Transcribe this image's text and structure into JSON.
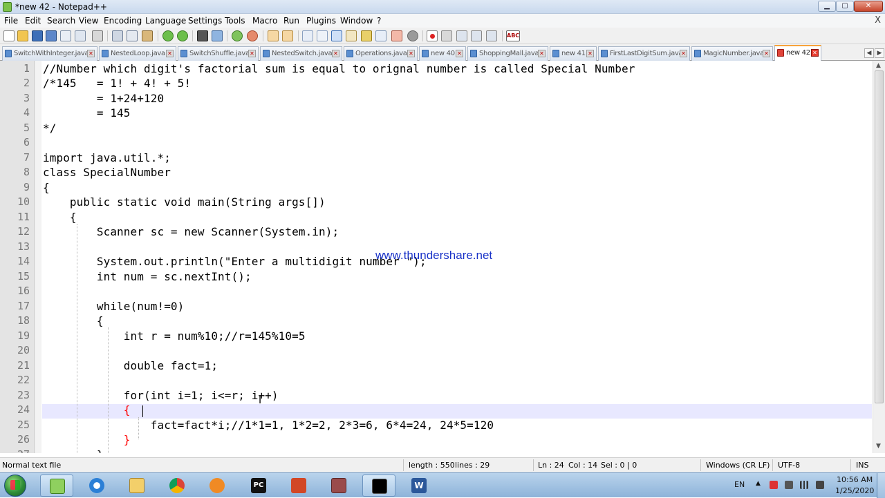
{
  "window": {
    "title": "*new 42 - Notepad++",
    "min_label": "▁",
    "max_label": "▢",
    "close_label": "✕"
  },
  "menu": {
    "items": [
      "File",
      "Edit",
      "Search",
      "View",
      "Encoding",
      "Language",
      "Settings",
      "Tools",
      "Macro",
      "Run",
      "Plugins",
      "Window",
      "?"
    ],
    "close_label": "X"
  },
  "toolbar": {
    "icons": [
      "new-file",
      "open-file",
      "save",
      "save-all",
      "close",
      "close-all",
      "print",
      "cut",
      "copy",
      "paste",
      "undo",
      "redo",
      "find",
      "replace",
      "zoom-in",
      "zoom-out",
      "sync-vertical",
      "sync-horizontal",
      "word-wrap",
      "show-all-chars",
      "indent-guide",
      "user-defined-language",
      "doc-map",
      "function-list",
      "folder-as-workspace",
      "record-macro",
      "stop-record",
      "play-macro",
      "run-macro-multiple",
      "save-macro",
      "spell-check"
    ],
    "spell_check_label": "ABC"
  },
  "tabs": [
    {
      "label": "SwitchWithInteger.java",
      "active": false
    },
    {
      "label": "NestedLoop.java",
      "active": false
    },
    {
      "label": "SwitchShuffle.java",
      "active": false
    },
    {
      "label": "NestedSwitch.java",
      "active": false
    },
    {
      "label": "Operations.java",
      "active": false
    },
    {
      "label": "new 40",
      "active": false
    },
    {
      "label": "ShoppingMall.java",
      "active": false
    },
    {
      "label": "new 41",
      "active": false
    },
    {
      "label": "FirstLastDigitSum.java",
      "active": false
    },
    {
      "label": "MagicNumber.java",
      "active": false
    },
    {
      "label": "new 42",
      "active": true
    }
  ],
  "tab_close_label": "✕",
  "tab_arrows": [
    "◀",
    "▶",
    "✕"
  ],
  "editor": {
    "line_numbers": [
      "1",
      "2",
      "3",
      "4",
      "5",
      "6",
      "7",
      "8",
      "9",
      "10",
      "11",
      "12",
      "13",
      "14",
      "15",
      "16",
      "17",
      "18",
      "19",
      "20",
      "21",
      "22",
      "23",
      "24",
      "25",
      "26",
      "27"
    ],
    "lines": [
      "//Number which digit's factorial sum is equal to orignal number is called Special Number",
      "/*145   = 1! + 4! + 5!",
      "        = 1+24+120",
      "        = 145",
      "*/",
      "",
      "import java.util.*;",
      "class SpecialNumber",
      "{",
      "    public static void main(String args[])",
      "    {",
      "        Scanner sc = new Scanner(System.in);",
      "",
      "        System.out.println(\"Enter a multidigit number \");",
      "        int num = sc.nextInt();",
      "",
      "        while(num!=0)",
      "        {",
      "            int r = num%10;//r=145%10=5",
      "",
      "            double fact=1;",
      "",
      "            for(int i=1; i<=r; i++)",
      "            {",
      "                fact=fact*i;//1*1=1, 1*2=2, 2*3=6, 6*4=24, 24*5=120",
      "            }",
      "        }"
    ],
    "watermark": "www.thundershare.net"
  },
  "status": {
    "file_type": "Normal text file",
    "length": "length : 550",
    "lines": "lines : 29",
    "ln": "Ln : 24",
    "col": "Col : 14",
    "sel": "Sel : 0 | 0",
    "eol": "Windows (CR LF)",
    "encoding": "UTF-8",
    "mode": "INS"
  },
  "taskbar": {
    "apps": [
      "notepad-plus-plus",
      "internet-explorer",
      "file-explorer",
      "chrome",
      "media-player",
      "pycharm",
      "powerpoint",
      "archive-tool",
      "command-prompt",
      "word"
    ],
    "active_app": "notepad-plus-plus",
    "language": "EN",
    "time": "10:56 AM",
    "date": "1/25/2020",
    "tray_arrow": "▲"
  },
  "colors": {
    "current_line": "#e8e8ff",
    "brace_highlight": "#ff0000",
    "watermark": "#1a33c8",
    "active_tab_accent": "#f7a33b"
  }
}
